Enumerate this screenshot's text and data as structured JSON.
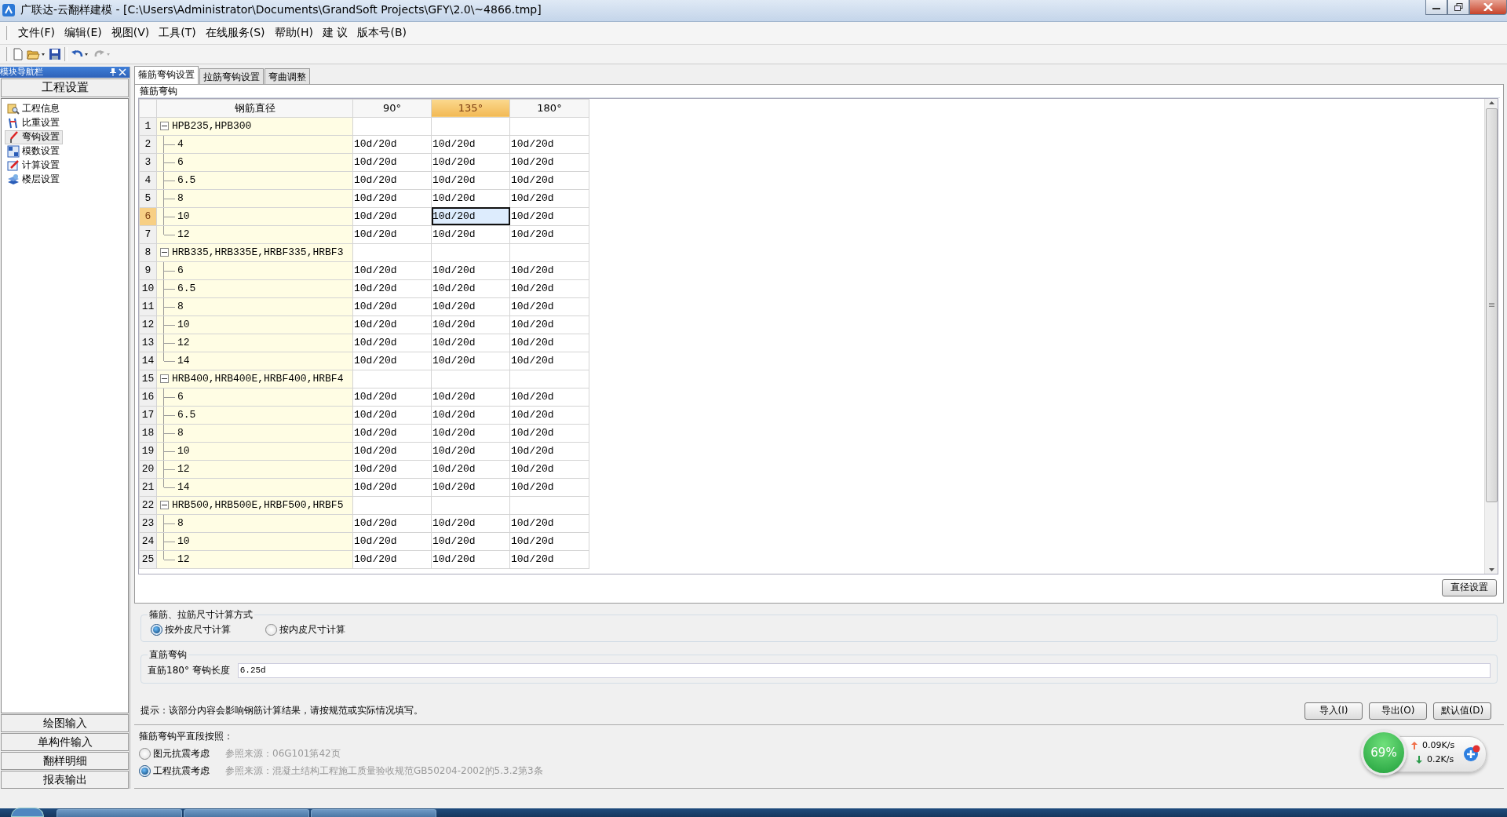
{
  "window": {
    "title": "广联达-云翻样建模 - [C:\\Users\\Administrator\\Documents\\GrandSoft Projects\\GFY\\2.0\\~4866.tmp]"
  },
  "menu": [
    "文件(F)",
    "编辑(E)",
    "视图(V)",
    "工具(T)",
    "在线服务(S)",
    "帮助(H)",
    "建 议",
    "版本号(B)"
  ],
  "nav": {
    "title": "模块导航栏",
    "section": "工程设置",
    "items": [
      {
        "label": "工程信息",
        "selected": false
      },
      {
        "label": "比重设置",
        "selected": false
      },
      {
        "label": "弯钩设置",
        "selected": true
      },
      {
        "label": "模数设置",
        "selected": false
      },
      {
        "label": "计算设置",
        "selected": false
      },
      {
        "label": "楼层设置",
        "selected": false
      }
    ],
    "modules": [
      "绘图输入",
      "单构件输入",
      "翻样明细",
      "报表输出"
    ]
  },
  "tabs": [
    {
      "label": "箍筋弯钩设置",
      "selected": true
    },
    {
      "label": "拉筋弯钩设置",
      "selected": false
    },
    {
      "label": "弯曲调整",
      "selected": false
    }
  ],
  "hook_table": {
    "group_title": "箍筋弯钩",
    "columns": [
      {
        "label": "钢筋直径",
        "selected": false
      },
      {
        "label": "90°",
        "selected": false
      },
      {
        "label": "135°",
        "selected": true
      },
      {
        "label": "180°",
        "selected": false
      }
    ],
    "rows": [
      {
        "number": "1",
        "label": "HPB235,HPB300",
        "expanded": true,
        "selected": false,
        "children": [
          {
            "number": "2",
            "label": "4",
            "selected": false,
            "values": [
              "10d/20d",
              "10d/20d",
              "10d/20d"
            ]
          },
          {
            "number": "3",
            "label": "6",
            "selected": false,
            "values": [
              "10d/20d",
              "10d/20d",
              "10d/20d"
            ]
          },
          {
            "number": "4",
            "label": "6.5",
            "selected": false,
            "values": [
              "10d/20d",
              "10d/20d",
              "10d/20d"
            ]
          },
          {
            "number": "5",
            "label": "8",
            "selected": false,
            "values": [
              "10d/20d",
              "10d/20d",
              "10d/20d"
            ]
          },
          {
            "number": "6",
            "label": "10",
            "selected": true,
            "values": [
              "10d/20d",
              "10d/20d",
              "10d/20d"
            ]
          },
          {
            "number": "7",
            "label": "12",
            "selected": false,
            "values": [
              "10d/20d",
              "10d/20d",
              "10d/20d"
            ]
          }
        ]
      },
      {
        "number": "8",
        "label": "HRB335,HRB335E,HRBF335,HRBF3",
        "expanded": true,
        "selected": false,
        "children": [
          {
            "number": "9",
            "label": "6",
            "selected": false,
            "values": [
              "10d/20d",
              "10d/20d",
              "10d/20d"
            ]
          },
          {
            "number": "10",
            "label": "6.5",
            "selected": false,
            "values": [
              "10d/20d",
              "10d/20d",
              "10d/20d"
            ]
          },
          {
            "number": "11",
            "label": "8",
            "selected": false,
            "values": [
              "10d/20d",
              "10d/20d",
              "10d/20d"
            ]
          },
          {
            "number": "12",
            "label": "10",
            "selected": false,
            "values": [
              "10d/20d",
              "10d/20d",
              "10d/20d"
            ]
          },
          {
            "number": "13",
            "label": "12",
            "selected": false,
            "values": [
              "10d/20d",
              "10d/20d",
              "10d/20d"
            ]
          },
          {
            "number": "14",
            "label": "14",
            "selected": false,
            "values": [
              "10d/20d",
              "10d/20d",
              "10d/20d"
            ]
          }
        ]
      },
      {
        "number": "15",
        "label": "HRB400,HRB400E,HRBF400,HRBF4",
        "expanded": true,
        "selected": false,
        "children": [
          {
            "number": "16",
            "label": "6",
            "selected": false,
            "values": [
              "10d/20d",
              "10d/20d",
              "10d/20d"
            ]
          },
          {
            "number": "17",
            "label": "6.5",
            "selected": false,
            "values": [
              "10d/20d",
              "10d/20d",
              "10d/20d"
            ]
          },
          {
            "number": "18",
            "label": "8",
            "selected": false,
            "values": [
              "10d/20d",
              "10d/20d",
              "10d/20d"
            ]
          },
          {
            "number": "19",
            "label": "10",
            "selected": false,
            "values": [
              "10d/20d",
              "10d/20d",
              "10d/20d"
            ]
          },
          {
            "number": "20",
            "label": "12",
            "selected": false,
            "values": [
              "10d/20d",
              "10d/20d",
              "10d/20d"
            ]
          },
          {
            "number": "21",
            "label": "14",
            "selected": false,
            "values": [
              "10d/20d",
              "10d/20d",
              "10d/20d"
            ]
          }
        ]
      },
      {
        "number": "22",
        "label": "HRB500,HRB500E,HRBF500,HRBF5",
        "expanded": true,
        "selected": false,
        "children": [
          {
            "number": "23",
            "label": "8",
            "selected": false,
            "values": [
              "10d/20d",
              "10d/20d",
              "10d/20d"
            ]
          },
          {
            "number": "24",
            "label": "10",
            "selected": false,
            "values": [
              "10d/20d",
              "10d/20d",
              "10d/20d"
            ]
          },
          {
            "number": "25",
            "label": "12",
            "selected": false,
            "values": [
              "10d/20d",
              "10d/20d",
              "10d/20d"
            ]
          }
        ]
      }
    ]
  },
  "diameter_button": "直径设置",
  "calc_method": {
    "title": "箍筋、拉筋尺寸计算方式",
    "options": [
      {
        "label": "按外皮尺寸计算",
        "selected": true
      },
      {
        "label": "按内皮尺寸计算",
        "selected": false
      }
    ]
  },
  "straight_hook": {
    "title": "直筋弯钩",
    "label": "直筋180° 弯钩长度",
    "value": "6.25d"
  },
  "hint": "提示：该部分内容会影响钢筋计算结果，请按规范或实际情况填写。",
  "actions": [
    "导入(I)",
    "导出(O)",
    "默认值(D)"
  ],
  "flat_segment": {
    "title": "箍筋弯钩平直段按照：",
    "options": [
      {
        "label": "图元抗震考虑",
        "source": "参照来源：06G101第42页",
        "selected": false
      },
      {
        "label": "工程抗震考虑",
        "source": "参照来源：混凝土结构工程施工质量验收规范GB50204-2002的5.3.2第3条",
        "selected": true
      }
    ]
  },
  "net_widget": {
    "percent": "69%",
    "upload": "0.09K/s",
    "download": "0.2K/s"
  }
}
